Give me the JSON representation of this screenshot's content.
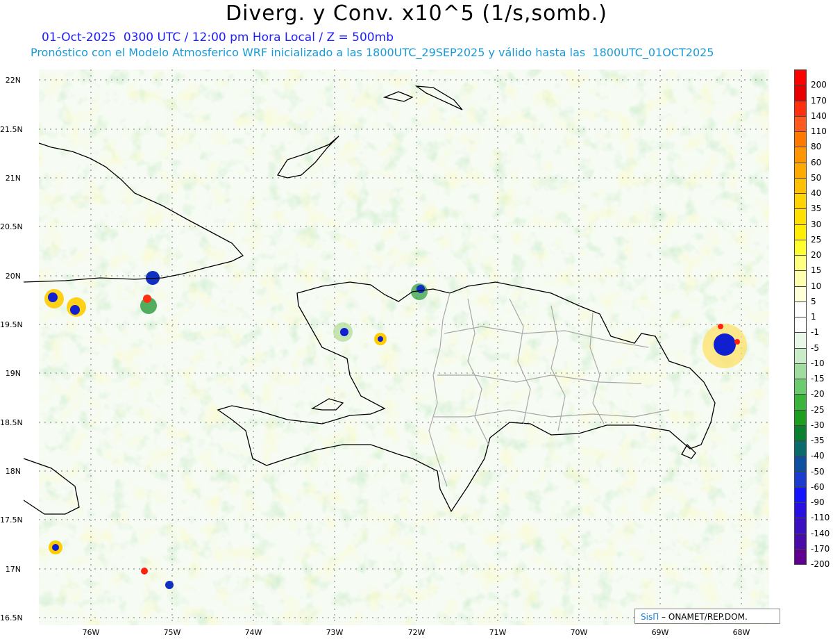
{
  "title": "Diverg. y Conv. x10^5 (1/s,somb.)",
  "subtitle1": "01-Oct-2025  0300 UTC / 12:00 pm Hora Local / Z = 500mb",
  "subtitle2": "Pronóstico con el Modelo Atmosferico WRF inicializado a las 1800UTC_29SEP2025 y válido hasta las  1800UTC_01OCT2025",
  "lat_labels": [
    "22N",
    "21.5N",
    "21N",
    "20.5N",
    "20N",
    "19.5N",
    "19N",
    "18.5N",
    "18N",
    "17.5N",
    "17N",
    "16.5N"
  ],
  "lon_labels": [
    "76W",
    "75W",
    "74W",
    "73W",
    "72W",
    "71W",
    "70W",
    "69W",
    "68W"
  ],
  "colorbar": {
    "labels": [
      "200",
      "170",
      "140",
      "110",
      "80",
      "60",
      "50",
      "40",
      "35",
      "30",
      "25",
      "20",
      "15",
      "10",
      "5",
      "1",
      "-1",
      "-5",
      "-10",
      "-15",
      "-20",
      "-25",
      "-30",
      "-35",
      "-40",
      "-50",
      "-60",
      "-90",
      "-110",
      "-140",
      "-170",
      "-200"
    ],
    "colors": [
      "#ff0000",
      "#e80000",
      "#ff3010",
      "#ff5a20",
      "#ff7800",
      "#ff9600",
      "#ffaa00",
      "#ffc000",
      "#ffd400",
      "#ffe000",
      "#ffee00",
      "#ffff30",
      "#ffff80",
      "#ffffb0",
      "#ffffd8",
      "#ffffff",
      "#ffffff",
      "#e8f7e8",
      "#c8ecc8",
      "#a0dca0",
      "#6ccb6c",
      "#3cb43c",
      "#1e9e1e",
      "#0a8030",
      "#0b6a6a",
      "#1050a0",
      "#1c3cd0",
      "#1414ff",
      "#2a10e0",
      "#3a10c0",
      "#4a0ca8",
      "#600090"
    ]
  },
  "credit": {
    "brand": "SisΠ",
    "text": " ONAMET/REP.DOM."
  }
}
